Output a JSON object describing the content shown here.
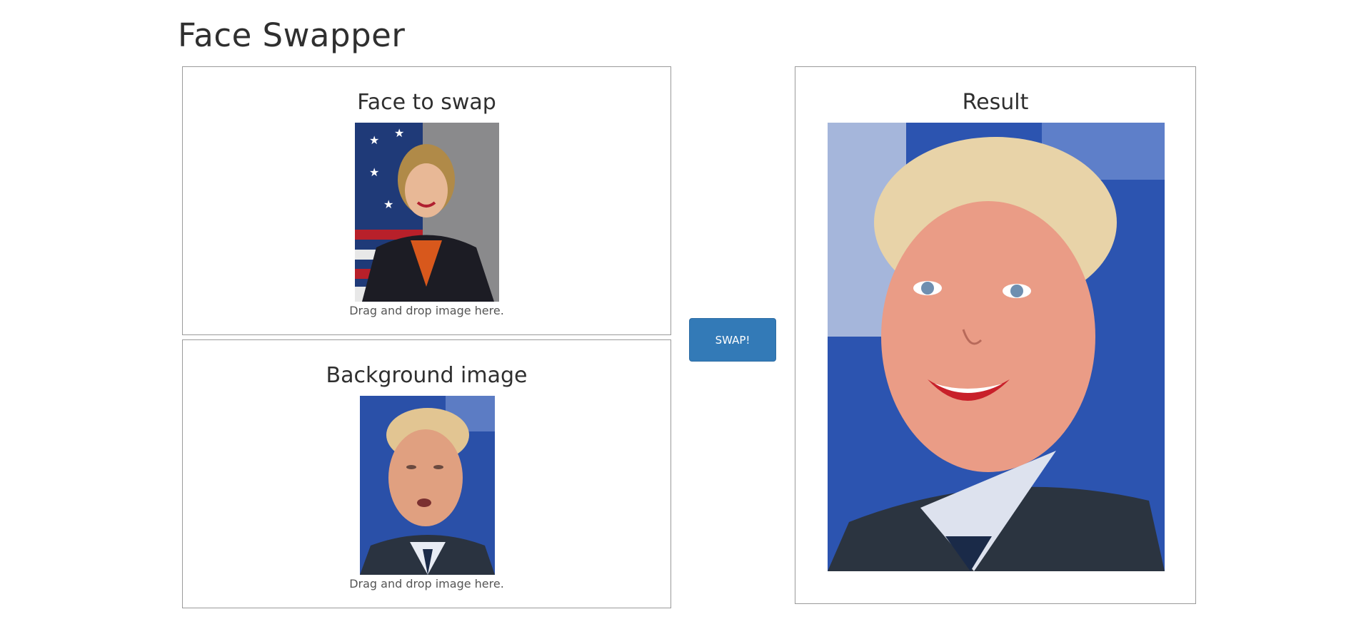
{
  "app": {
    "title": "Face Swapper"
  },
  "face_panel": {
    "title": "Face to swap",
    "hint": "Drag and drop image here.",
    "image_icon": "portrait-photo"
  },
  "background_panel": {
    "title": "Background image",
    "hint": "Drag and drop image here.",
    "image_icon": "portrait-photo"
  },
  "swap": {
    "label": "SWAP!",
    "color": "#337ab7"
  },
  "result_panel": {
    "title": "Result",
    "image_icon": "portrait-photo"
  }
}
